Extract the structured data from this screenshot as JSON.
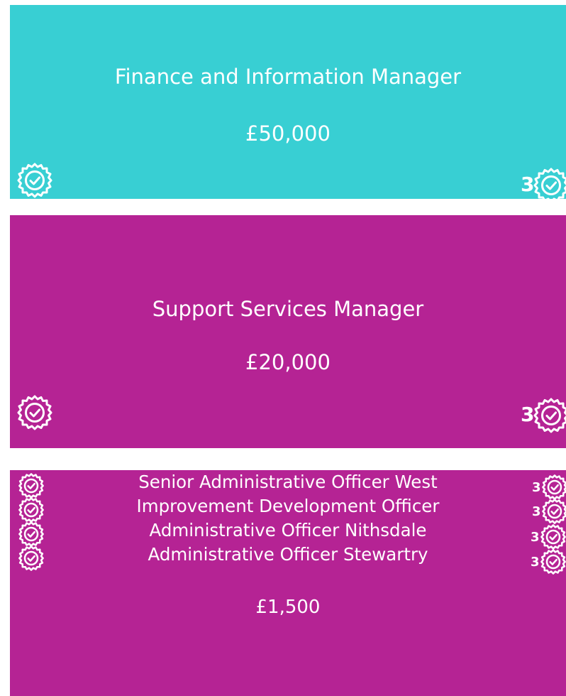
{
  "cards": [
    {
      "title": "Finance and Information Manager",
      "salary": "£50,000",
      "badge_count": "3",
      "color": "#38cfd3"
    },
    {
      "title": "Support Services Manager",
      "salary": "£20,000",
      "badge_count": "3",
      "color": "#b52394"
    }
  ],
  "group": {
    "color": "#b52394",
    "roles": [
      {
        "title": "Senior Administrative Officer West",
        "badge_count": "3"
      },
      {
        "title": "Improvement Development Officer",
        "badge_count": "3"
      },
      {
        "title": "Administrative Officer Nithsdale",
        "badge_count": "3"
      },
      {
        "title": "Administrative Officer Stewartry",
        "badge_count": "3"
      }
    ],
    "salary": "£1,500"
  },
  "icons": {
    "badge": "verified-badge-icon"
  }
}
